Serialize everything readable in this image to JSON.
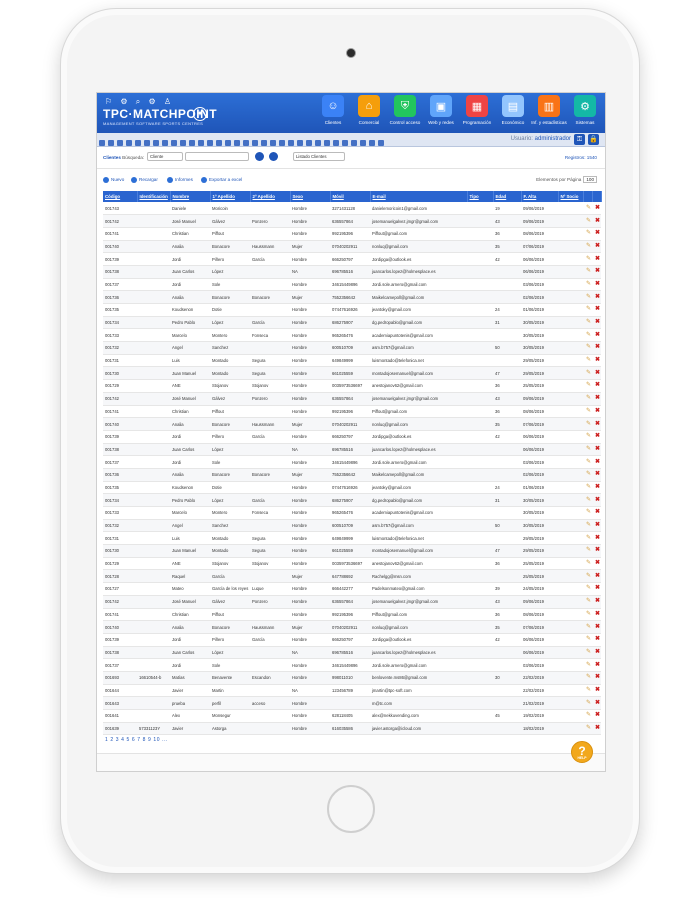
{
  "header": {
    "logo": "TPC·MATCHPOINT",
    "logo_sub": "MANAGEMENT SOFTWARE SPORTS CENTRES",
    "modules": [
      {
        "label": "Clientes",
        "icon": "clients-icon",
        "color": "#3b82f6"
      },
      {
        "label": "Comercial",
        "icon": "commercial-icon",
        "color": "#f59e0b"
      },
      {
        "label": "Control acceso",
        "icon": "access-control-icon",
        "color": "#22c55e"
      },
      {
        "label": "Web y redes",
        "icon": "web-icon",
        "color": "#60a5fa"
      },
      {
        "label": "Programación",
        "icon": "calendar-icon",
        "color": "#ef4444"
      },
      {
        "label": "Económico",
        "icon": "economic-icon",
        "color": "#93c5fd"
      },
      {
        "label": "Inf. y estadísticas",
        "icon": "stats-icon",
        "color": "#f97316"
      },
      {
        "label": "Sistemas",
        "icon": "systems-icon",
        "color": "#14b8a6"
      }
    ]
  },
  "toolbar": {
    "user_label": "Usuario:",
    "user_name": "administrador"
  },
  "filters": {
    "section": "Clientes",
    "search_label": "Búsqueda:",
    "search_field": "Cliente",
    "list_select": "Listado Clientes",
    "registros": "Registros: 1540"
  },
  "actions": {
    "nuevo": "Nuevo",
    "recargar": "Recargar",
    "informes": "Informes",
    "exportar": "Exportar a excel",
    "per_page_label": "Elementos por Página",
    "per_page_value": "100"
  },
  "columns": [
    "Código",
    "Identificación",
    "Nombre",
    "1º Apellido",
    "2º Apellido",
    "Sexo",
    "Móvil",
    "E-mail",
    "Tipo",
    "Edad",
    "F. Alta",
    "Nº Socio"
  ],
  "rows": [
    [
      "001743",
      "",
      "Daniele",
      "Moricoin",
      "",
      "Hombre",
      "3271431128",
      "danielemoricoin1@gmail.com",
      "",
      "19",
      "09/06/2019",
      ""
    ],
    [
      "001742",
      "",
      "José Manuel",
      "Gálvez",
      "Ponzero",
      "Hombre",
      "636557864",
      "josemanuelgalvez.jmgr@gmail.com",
      "",
      "43",
      "09/06/2019",
      ""
    ],
    [
      "001741",
      "",
      "Christian",
      "Piffout",
      "",
      "Hombre",
      "992195396",
      "Piffout@gmail.com",
      "",
      "36",
      "08/06/2019",
      ""
    ],
    [
      "001740",
      "",
      "Analia",
      "Bonacore",
      "Haussmann",
      "Mujer",
      "07040202911",
      "nonluq@gmail.com",
      "",
      "35",
      "07/06/2019",
      ""
    ],
    [
      "001739",
      "",
      "Jordi",
      "Piñero",
      "García",
      "Hombre",
      "666250797",
      "Jordipga@outlook.es",
      "",
      "42",
      "06/06/2019",
      ""
    ],
    [
      "001738",
      "",
      "Juan Carlos",
      "López",
      "",
      "NA",
      "696785516",
      "juancarlos.lopez@holmesplace.es",
      "",
      "",
      "06/06/2019",
      ""
    ],
    [
      "001737",
      "",
      "Jordi",
      "Sole",
      "",
      "Hombre",
      "34615449896",
      "Jordi.sole.arnero@gmail.com",
      "",
      "",
      "03/06/2019",
      ""
    ],
    [
      "001736",
      "",
      "Analia",
      "Bonacore",
      "Bonacore",
      "Mujer",
      "7552356642",
      "Maikelcamepoll@gmail.com",
      "",
      "",
      "02/06/2019",
      ""
    ],
    [
      "001735",
      "",
      "Koudsenon",
      "Dotie",
      "",
      "Hombre",
      "07447616926",
      "jeantoky@gmail.com",
      "",
      "24",
      "01/06/2019",
      ""
    ],
    [
      "001734",
      "",
      "Pedro Pablo",
      "López",
      "García",
      "Hombre",
      "686275907",
      "dg.pedropablo@gmail.com",
      "",
      "31",
      "30/05/2019",
      ""
    ],
    [
      "001733",
      "",
      "Marcelo",
      "Montero",
      "Fonseca",
      "Hombre",
      "965265476",
      "academiapuntotenis@gmail.com",
      "",
      "",
      "30/05/2019",
      ""
    ],
    [
      "001732",
      "",
      "Angel",
      "Sanchez",
      "",
      "Hombre",
      "600510709",
      "asm.b757@gmail.com",
      "",
      "50",
      "30/05/2019",
      ""
    ],
    [
      "001731",
      "",
      "Luis",
      "Montado",
      "Segura",
      "Hombre",
      "649849999",
      "luismontado@telefonica.net",
      "",
      "",
      "29/05/2019",
      ""
    ],
    [
      "001730",
      "",
      "Juan Manuel",
      "Montado",
      "Segura",
      "Hombre",
      "661025559",
      "montadojosemanuel@gmail.com",
      "",
      "47",
      "29/05/2019",
      ""
    ],
    [
      "001729",
      "",
      "ANE",
      "Stojanov",
      "Stojanov",
      "Hombre",
      "0035973536697",
      "anestojanov62@gmail.com",
      "",
      "36",
      "25/05/2019",
      ""
    ],
    [
      "001742",
      "",
      "José Manuel",
      "Gálvez",
      "Ponzero",
      "Hombre",
      "636557864",
      "josemanuelgalvez.jmgr@gmail.com",
      "",
      "43",
      "09/06/2019",
      ""
    ],
    [
      "001741",
      "",
      "Christian",
      "Piffout",
      "",
      "Hombre",
      "992195396",
      "Piffout@gmail.com",
      "",
      "36",
      "08/06/2019",
      ""
    ],
    [
      "001740",
      "",
      "Analia",
      "Bonacore",
      "Haussmann",
      "Mujer",
      "07040202911",
      "nonluq@gmail.com",
      "",
      "35",
      "07/06/2019",
      ""
    ],
    [
      "001739",
      "",
      "Jordi",
      "Piñero",
      "García",
      "Hombre",
      "666250797",
      "Jordipga@outlook.es",
      "",
      "42",
      "06/06/2019",
      ""
    ],
    [
      "001738",
      "",
      "Juan Carlos",
      "López",
      "",
      "NA",
      "696785516",
      "juancarlos.lopez@holmesplace.es",
      "",
      "",
      "06/06/2019",
      ""
    ],
    [
      "001737",
      "",
      "Jordi",
      "Sole",
      "",
      "Hombre",
      "34615449896",
      "Jordi.sole.arnero@gmail.com",
      "",
      "",
      "03/06/2019",
      ""
    ],
    [
      "001736",
      "",
      "Analia",
      "Bonacore",
      "Bonacore",
      "Mujer",
      "7552356642",
      "Maikelcamepoll@gmail.com",
      "",
      "",
      "02/06/2019",
      ""
    ],
    [
      "001735",
      "",
      "Koudsenon",
      "Dotie",
      "",
      "Hombre",
      "07447616926",
      "jeantoky@gmail.com",
      "",
      "24",
      "01/06/2019",
      ""
    ],
    [
      "001734",
      "",
      "Pedro Pablo",
      "López",
      "García",
      "Hombre",
      "686275907",
      "dg.pedropablo@gmail.com",
      "",
      "31",
      "30/05/2019",
      ""
    ],
    [
      "001733",
      "",
      "Marcelo",
      "Montero",
      "Fonseca",
      "Hombre",
      "965265476",
      "academiapuntotenis@gmail.com",
      "",
      "",
      "30/05/2019",
      ""
    ],
    [
      "001732",
      "",
      "Angel",
      "Sanchez",
      "",
      "Hombre",
      "600510709",
      "asm.b757@gmail.com",
      "",
      "50",
      "30/05/2019",
      ""
    ],
    [
      "001731",
      "",
      "Luis",
      "Montado",
      "Segura",
      "Hombre",
      "649849999",
      "luismontado@telefonica.net",
      "",
      "",
      "29/05/2019",
      ""
    ],
    [
      "001730",
      "",
      "Juan Manuel",
      "Montado",
      "Segura",
      "Hombre",
      "661025559",
      "montadojosemanuel@gmail.com",
      "",
      "47",
      "29/05/2019",
      ""
    ],
    [
      "001729",
      "",
      "ANE",
      "Stojanov",
      "Stojanov",
      "Hombre",
      "0035973536697",
      "anestojanov62@gmail.com",
      "",
      "36",
      "25/05/2019",
      ""
    ],
    [
      "001728",
      "",
      "Raquel",
      "García",
      "",
      "Mujer",
      "647788692",
      "Rachelgg@msn.com",
      "",
      "",
      "25/05/2019",
      ""
    ],
    [
      "001727",
      "",
      "Mateo",
      "García de los reyes",
      "Luque",
      "Hombre",
      "666442277",
      "Padelsonmateo@gmail.com",
      "",
      "39",
      "24/05/2019",
      ""
    ],
    [
      "001742",
      "",
      "José Manuel",
      "Gálvez",
      "Ponzero",
      "Hombre",
      "636557864",
      "josemanuelgalvez.jmgr@gmail.com",
      "",
      "43",
      "09/06/2019",
      ""
    ],
    [
      "001741",
      "",
      "Christian",
      "Piffout",
      "",
      "Hombre",
      "992195396",
      "Piffout@gmail.com",
      "",
      "36",
      "08/06/2019",
      ""
    ],
    [
      "001740",
      "",
      "Analia",
      "Bonacore",
      "Haussmann",
      "Mujer",
      "07040202911",
      "nonluq@gmail.com",
      "",
      "35",
      "07/06/2019",
      ""
    ],
    [
      "001739",
      "",
      "Jordi",
      "Piñero",
      "García",
      "Hombre",
      "666250797",
      "Jordipga@outlook.es",
      "",
      "42",
      "06/06/2019",
      ""
    ],
    [
      "001738",
      "",
      "Juan Carlos",
      "López",
      "",
      "NA",
      "696785516",
      "juancarlos.lopez@holmesplace.es",
      "",
      "",
      "06/06/2019",
      ""
    ],
    [
      "001737",
      "",
      "Jordi",
      "Sole",
      "",
      "Hombre",
      "34615449896",
      "Jordi.sole.arnero@gmail.com",
      "",
      "",
      "03/06/2019",
      ""
    ],
    [
      "001693",
      "16610544-b",
      "Matías",
      "Benavente",
      "Escandon",
      "Hombre",
      "998011010",
      "benlovente.ms86@gmail.com",
      "",
      "30",
      "22/02/2019",
      ""
    ],
    [
      "001644",
      "",
      "Javier",
      "Martin",
      "",
      "NA",
      "123456789",
      "jmartin@tpc-soft.com",
      "",
      "",
      "22/02/2019",
      ""
    ],
    [
      "001643",
      "",
      "prueba",
      "perfil",
      "acceso",
      "Hombre",
      "",
      "m@tc.com",
      "",
      "",
      "21/02/2019",
      ""
    ],
    [
      "001641",
      "",
      "Alex",
      "Monsegur",
      "",
      "Hombre",
      "628118405",
      "alex@nekkuvending.com",
      "",
      "45",
      "19/02/2019",
      ""
    ],
    [
      "001639",
      "57331123Y",
      "Javier",
      "Astorga",
      "",
      "Hombre",
      "616035586",
      "javier.astorga@icloud.com",
      "",
      "",
      "18/02/2019",
      ""
    ]
  ],
  "pager": "1 2 3 4 5 6 7 8 9 10 ...",
  "help_label": "HELP"
}
